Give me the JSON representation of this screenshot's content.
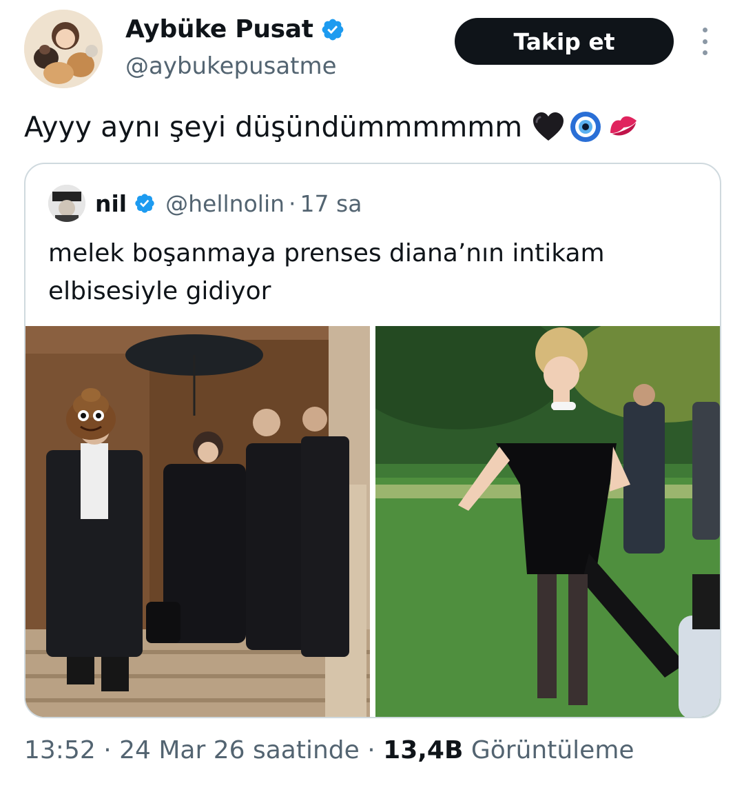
{
  "author": {
    "display_name": "Aybüke Pusat",
    "handle": "@aybukepusatme",
    "verified": true
  },
  "follow_button_label": "Takip et",
  "tweet": {
    "text": "Ayyy aynı şeyi düşündümmmmmm",
    "emojis": [
      "black-heart",
      "nazar-amulet",
      "kiss-mark"
    ]
  },
  "quoted_tweet": {
    "name": "nil",
    "verified": true,
    "handle": "@hellnolin",
    "separator": "·",
    "time": "17 sa",
    "text": "melek boşanmaya prenses diana’nın intikam elbisesiyle gidiyor",
    "media": [
      {
        "description_icon": "photo-icon",
        "content": "Photo of a group in black coats descending stone steps under an umbrella, with a poop emoji covering one face"
      },
      {
        "description_icon": "photo-icon",
        "content": "Photo of a woman in a black off-shoulder dress walking on a lawn"
      }
    ]
  },
  "meta": {
    "time": "13:52",
    "separator": "·",
    "date": "24 Mar 26 saatinde",
    "separator2": "·",
    "views_count": "13,4B",
    "views_label": "Görüntüleme"
  },
  "colors": {
    "text": "#0f1419",
    "secondary": "#536471",
    "verified_blue": "#1d9bf0",
    "button_bg": "#0f1419",
    "border": "#cfd9de"
  }
}
